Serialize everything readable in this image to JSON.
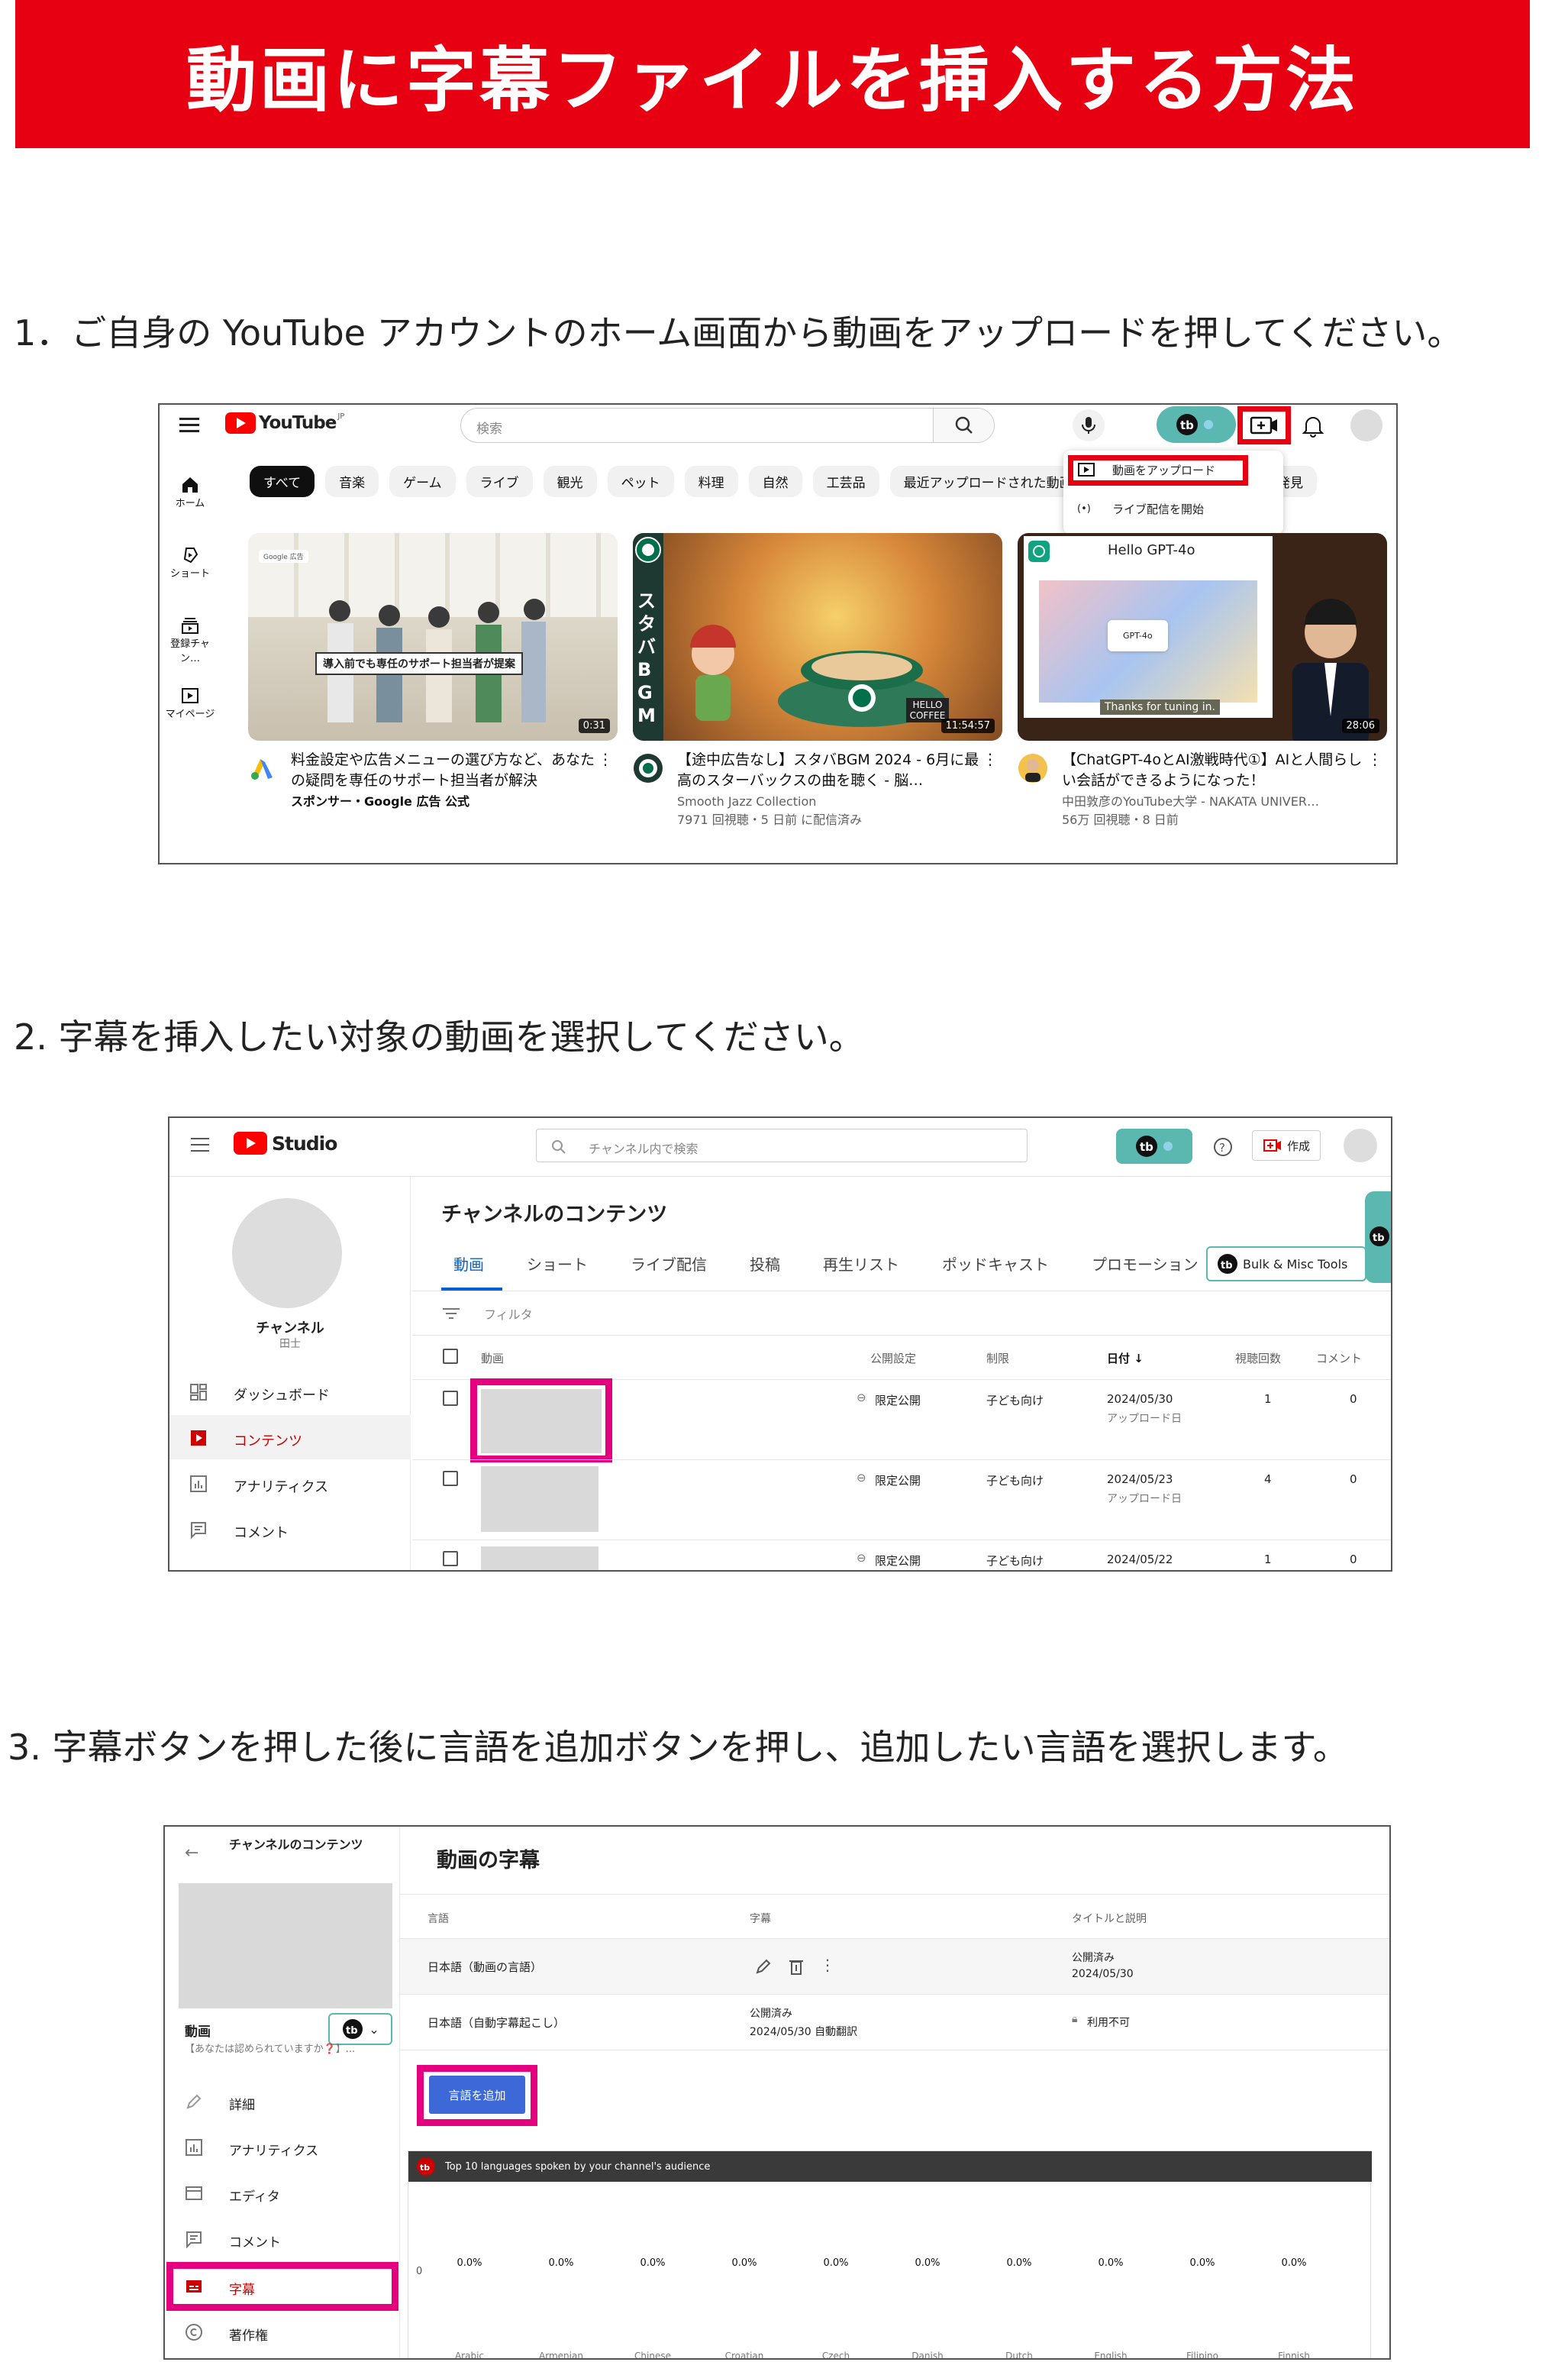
{
  "banner": {
    "title": "動画に字幕ファイルを挿入する方法"
  },
  "steps": {
    "s1": "1．ご自身の YouTube アカウントのホーム画面から動画をアップロードを押してください。",
    "s2": "2. 字幕を挿入したい対象の動画を選択してください。",
    "s3": "3. 字幕ボタンを押した後に言語を追加ボタンを押し、追加したい言語を選択します。"
  },
  "yt": {
    "logo": "YouTube",
    "region": "JP",
    "search_placeholder": "検索",
    "chips": [
      "すべて",
      "音楽",
      "ゲーム",
      "ライブ",
      "観光",
      "ペット",
      "料理",
      "自然",
      "工芸品",
      "最近アップロードされた動画",
      "発見"
    ],
    "nav": [
      "ホーム",
      "ショート",
      "登録チャン…",
      "マイページ"
    ],
    "menu": {
      "upload": "動画をアップロード",
      "live": "ライブ配信を開始"
    },
    "videos": [
      {
        "badge": "Google 広告",
        "caption": "導入前でも専任のサポート担当者が提案",
        "duration": "0:31",
        "title": "料金設定や広告メニューの選び方など、あなたの疑問を専任のサポート担当者が解決",
        "meta1": "スポンサー・Google 広告 公式",
        "meta2": ""
      },
      {
        "side_text": "スタバBGM",
        "cup_text": "HELLO COFFEE",
        "duration": "11:54:57",
        "title": "【途中広告なし】スタバBGM 2024 - 6月に最高のスターバックスの曲を聴く - 脳…",
        "meta1": "Smooth Jazz Collection",
        "meta2": "7971 回視聴・5 日前 に配信済み"
      },
      {
        "slide_title": "Hello GPT-4o",
        "slide_card": "GPT-4o",
        "slide_footer": "Thanks for tuning in.",
        "duration": "28:06",
        "title": "【ChatGPT-4oとAI激戦時代①】AIと人間らしい会話ができるようになった！",
        "meta1": "中田敦彦のYouTube大学 - NAKATA UNIVER…",
        "meta2": "56万 回視聴・8 日前"
      }
    ]
  },
  "studio": {
    "logo": "Studio",
    "search_placeholder": "チャンネル内で検索",
    "create": "作成",
    "channel_name": "チャンネル",
    "channel_sub": "田士",
    "nav": [
      "ダッシュボード",
      "コンテンツ",
      "アナリティクス",
      "コメント"
    ],
    "page_title": "チャンネルのコンテンツ",
    "tabs": [
      "動画",
      "ショート",
      "ライブ配信",
      "投稿",
      "再生リスト",
      "ポッドキャスト",
      "プロモーション"
    ],
    "bulk": "Bulk & Misc Tools",
    "filter": "フィルタ",
    "headers": [
      "動画",
      "公開設定",
      "制限",
      "日付 ↓",
      "視聴回数",
      "コメント"
    ],
    "rows": [
      {
        "vis": "限定公開",
        "restr": "子ども向け",
        "date": "2024/05/30",
        "date_sub": "アップロード日",
        "views": "1",
        "comments": "0"
      },
      {
        "vis": "限定公開",
        "restr": "子ども向け",
        "date": "2024/05/23",
        "date_sub": "アップロード日",
        "views": "4",
        "comments": "0"
      },
      {
        "vis": "限定公開",
        "restr": "子ども向け",
        "date": "2024/05/22",
        "date_sub": "",
        "views": "1",
        "comments": "0"
      }
    ]
  },
  "subs": {
    "back_label": "チャンネルのコンテンツ",
    "video_label": "動画",
    "video_sub": "【あなたは認められていますか❓】...",
    "nav": [
      "詳細",
      "アナリティクス",
      "エディタ",
      "コメント",
      "字幕",
      "著作権"
    ],
    "page_title": "動画の字幕",
    "headers": [
      "言語",
      "字幕",
      "タイトルと説明"
    ],
    "rows": [
      {
        "lang": "日本語（動画の言語）",
        "sub": "",
        "sub2": "",
        "title": "公開済み",
        "title2": "2024/05/30"
      },
      {
        "lang": "日本語（自動字幕起こし）",
        "sub": "公開済み",
        "sub2": "2024/05/30 自動翻訳",
        "title": "利用不可",
        "title2": ""
      }
    ],
    "add_button": "言語を追加",
    "chart_title": "Top 10 languages spoken by your channel's audience",
    "chart_zero": "0",
    "chart_data": {
      "type": "bar",
      "title": "Top 10 languages spoken by your channel's audience",
      "categories": [
        "Arabic",
        "Armenian",
        "Chinese",
        "Croatian",
        "Czech",
        "Danish",
        "Dutch",
        "English",
        "Filipino",
        "Finnish"
      ],
      "values": [
        0,
        0,
        0,
        0,
        0,
        0,
        0,
        0,
        0,
        0
      ],
      "value_labels": [
        "0.0%",
        "0.0%",
        "0.0%",
        "0.0%",
        "0.0%",
        "0.0%",
        "0.0%",
        "0.0%",
        "0.0%",
        "0.0%"
      ]
    }
  },
  "colors": {
    "brand_red": "#e60012",
    "highlight_pink": "#e4007f",
    "studio_blue": "#065fd4",
    "teal": "#5bb8b0",
    "add_btn": "#3c68d8"
  }
}
